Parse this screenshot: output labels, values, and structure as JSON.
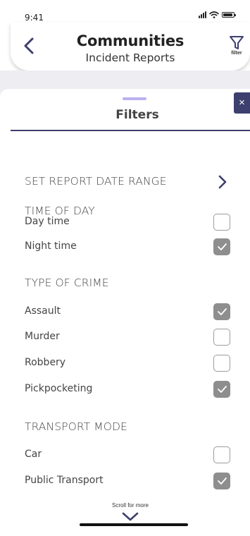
{
  "status_bar": {
    "time": "9:41",
    "icons": [
      "signal-icon",
      "wifi-icon",
      "battery-icon"
    ]
  },
  "header": {
    "title": "Communities",
    "subtitle": "Incident Reports",
    "filter_label": "filter",
    "icons": [
      "chevron-left-icon",
      "filter-funnel-icon"
    ]
  },
  "filters": {
    "title": "Filters",
    "close_symbol": "×",
    "date_range": {
      "label": "SET REPORT DATE RANGE",
      "icon": "chevron-right-icon"
    },
    "sections": [
      {
        "heading": "TIME OF DAY",
        "options": [
          {
            "label": "Day time",
            "checked": false
          },
          {
            "label": "Night time",
            "checked": true
          }
        ]
      },
      {
        "heading": "TYPE OF CRIME",
        "options": [
          {
            "label": "Assault",
            "checked": true
          },
          {
            "label": "Murder",
            "checked": false
          },
          {
            "label": "Robbery",
            "checked": false
          },
          {
            "label": "Pickpocketing",
            "checked": true
          }
        ]
      },
      {
        "heading": "TRANSPORT MODE",
        "options": [
          {
            "label": "Car",
            "checked": false
          },
          {
            "label": "Public Transport",
            "checked": true
          }
        ]
      }
    ]
  },
  "scroll_hint": "Scroll for more",
  "colors": {
    "accent_dark": "#3d3f6e",
    "drag_handle": "#b9b1f0",
    "checked_fill": "#8e8e8e",
    "band": "#eeeef2"
  }
}
